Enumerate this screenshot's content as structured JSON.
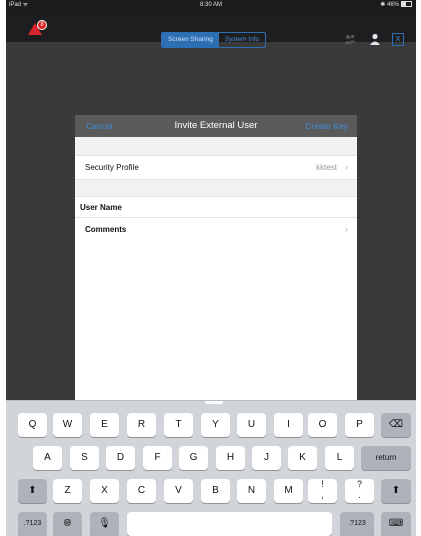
{
  "status_bar": {
    "carrier": "iPad",
    "time": "8:30 AM",
    "battery": "46%"
  },
  "toolbar": {
    "alert_badge": "8",
    "tabs": [
      {
        "label": "Screen Sharing",
        "active": true
      },
      {
        "label": "System Info",
        "active": false
      }
    ],
    "close_label": "X"
  },
  "modal": {
    "cancel": "Cancel",
    "title": "Invite External User",
    "create_key": "Create Key",
    "security_profile": {
      "label": "Security Profile",
      "value": "kktest"
    },
    "user_name": {
      "label": "User Name"
    },
    "comments": {
      "label": "Comments"
    }
  },
  "keyboard": {
    "row1": [
      "Q",
      "W",
      "E",
      "R",
      "T",
      "Y",
      "U",
      "I",
      "O",
      "P"
    ],
    "row2": [
      "A",
      "S",
      "D",
      "F",
      "G",
      "H",
      "J",
      "K",
      "L"
    ],
    "row3": [
      "Z",
      "X",
      "C",
      "V",
      "B",
      "N",
      "M",
      "!",
      ",",
      "?",
      "."
    ],
    "return": "return",
    "numbers": ".?123",
    "icons": {
      "delete": "backspace-icon",
      "shift": "shift-icon",
      "globe": "globe-icon",
      "mic": "microphone-icon",
      "dismiss": "keyboard-dismiss-icon"
    }
  },
  "colors": {
    "accent": "#3f8de0",
    "alert": "#d9262e",
    "toolbar_bg": "#1e1e20",
    "modal_header_bg": "#5a5a5a"
  }
}
